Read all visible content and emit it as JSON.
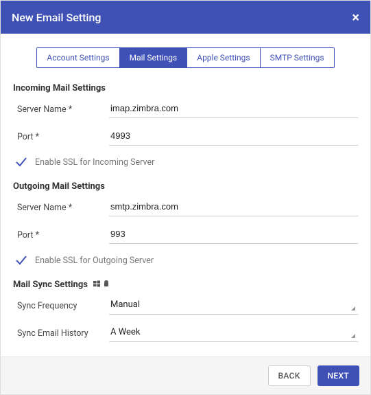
{
  "header": {
    "title": "New Email Setting"
  },
  "tabs": {
    "account": "Account Settings",
    "mail": "Mail Settings",
    "apple": "Apple Settings",
    "smtp": "SMTP Settings"
  },
  "incoming": {
    "title": "Incoming Mail Settings",
    "server_label": "Server Name *",
    "server_value": "imap.zimbra.com",
    "port_label": "Port *",
    "port_value": "4993",
    "ssl_label": "Enable SSL for Incoming Server"
  },
  "outgoing": {
    "title": "Outgoing Mail Settings",
    "server_label": "Server Name *",
    "server_value": "smtp.zimbra.com",
    "port_label": "Port *",
    "port_value": "993",
    "ssl_label": "Enable SSL for Outgoing Server"
  },
  "mailsync": {
    "title": "Mail Sync Settings",
    "freq_label": "Sync Frequency",
    "freq_value": "Manual",
    "hist_label": "Sync Email History",
    "hist_value": "A Week"
  },
  "footer": {
    "back": "BACK",
    "next": "NEXT"
  }
}
